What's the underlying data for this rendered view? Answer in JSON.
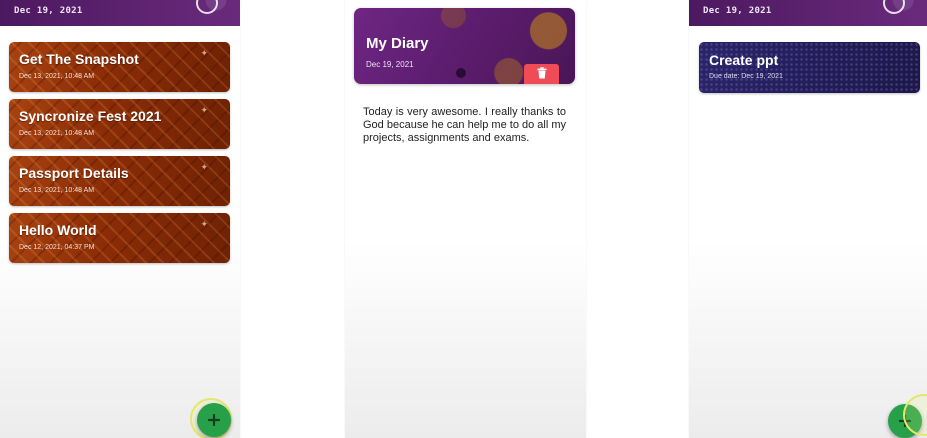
{
  "status_bar": {
    "date_left": "Dec 19, 2021",
    "date_right": "Dec 19, 2021"
  },
  "diary_list": {
    "items": [
      {
        "title": "Get The Snapshot",
        "date": "Dec 13, 2021, 10:48 AM"
      },
      {
        "title": "Syncronize Fest 2021",
        "date": "Dec 13, 2021, 10:48 AM"
      },
      {
        "title": "Passport Details",
        "date": "Dec 13, 2021, 10:48 AM"
      },
      {
        "title": "Hello World",
        "date": "Dec 12, 2021, 04:37 PM"
      }
    ]
  },
  "diary_detail": {
    "title": "My Diary",
    "date": "Dec 19, 2021",
    "body": "Today is very awesome. I really thanks to God because he can help me to do all my projects, assignments and exams."
  },
  "todo": {
    "items": [
      {
        "title": "Create ppt",
        "due": "Due date: Dec 19, 2021"
      }
    ]
  },
  "icons": {
    "add": "add-icon",
    "delete": "trash-icon"
  },
  "colors": {
    "status_bar": "#5b1f6e",
    "diary_card": "#8f3208",
    "todo_card": "#252060",
    "fab": "#27a04a",
    "delete_button": "#ef4c58"
  }
}
